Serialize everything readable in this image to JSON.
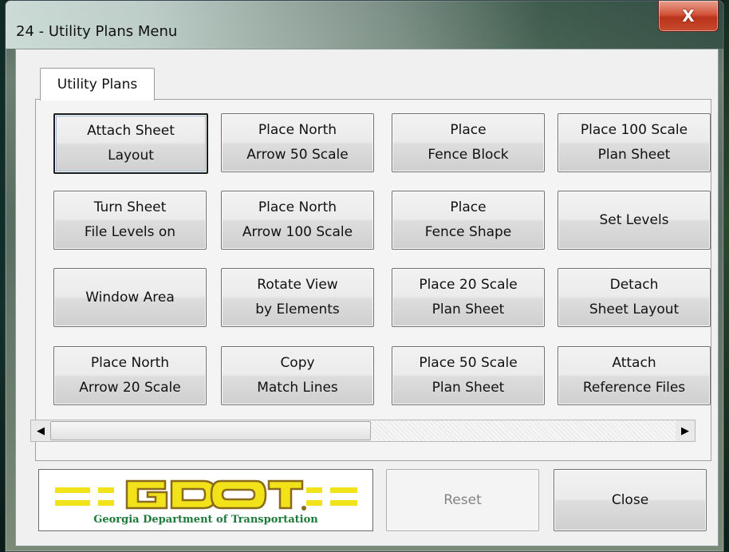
{
  "window": {
    "title": "24 - Utility Plans Menu",
    "close_glyph": "X"
  },
  "tabs": [
    {
      "label": "Utility Plans"
    }
  ],
  "buttons": [
    {
      "label": "Attach Sheet\nLayout"
    },
    {
      "label": "Place North\nArrow 50 Scale"
    },
    {
      "label": "Place\nFence Block"
    },
    {
      "label": "Place 100 Scale\nPlan Sheet"
    },
    {
      "label": "Turn Sheet\nFile Levels on"
    },
    {
      "label": "Place North\nArrow 100 Scale"
    },
    {
      "label": "Place\nFence Shape"
    },
    {
      "label": "Set Levels"
    },
    {
      "label": "Window Area"
    },
    {
      "label": "Rotate View\nby Elements"
    },
    {
      "label": "Place 20 Scale\nPlan Sheet"
    },
    {
      "label": "Detach\nSheet Layout"
    },
    {
      "label": "Place North\nArrow 20 Scale"
    },
    {
      "label": "Copy\nMatch Lines"
    },
    {
      "label": "Place 50 Scale\nPlan Sheet"
    },
    {
      "label": "Attach\nReference Files"
    }
  ],
  "scrollbar": {
    "left_arrow": "◀",
    "right_arrow": "▶"
  },
  "logo": {
    "wordmark": "GDOT",
    "caption": "Georgia Department of Transportation",
    "colors": {
      "yellow": "#f2e21a",
      "brown": "#8a6a1d",
      "green": "#1d7a3a"
    }
  },
  "footer": {
    "reset_label": "Reset",
    "close_label": "Close"
  }
}
